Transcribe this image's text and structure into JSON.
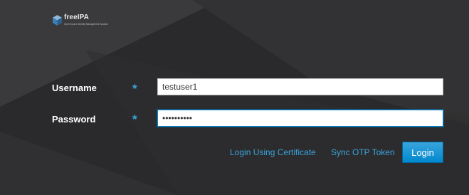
{
  "brand": {
    "name": "freeIPA",
    "tagline": "Open Source Identity Management Solution"
  },
  "form": {
    "username": {
      "label": "Username",
      "required_marker": "*",
      "value": "testuser1"
    },
    "password": {
      "label": "Password",
      "required_marker": "*",
      "value": "••••••••••"
    }
  },
  "actions": {
    "certificate_link": "Login Using Certificate",
    "sync_otp_link": "Sync OTP Token",
    "login_button": "Login"
  },
  "colors": {
    "background": "#2a2a2c",
    "accent": "#39a5dc",
    "button": "#0088ce",
    "text": "#ffffff"
  }
}
